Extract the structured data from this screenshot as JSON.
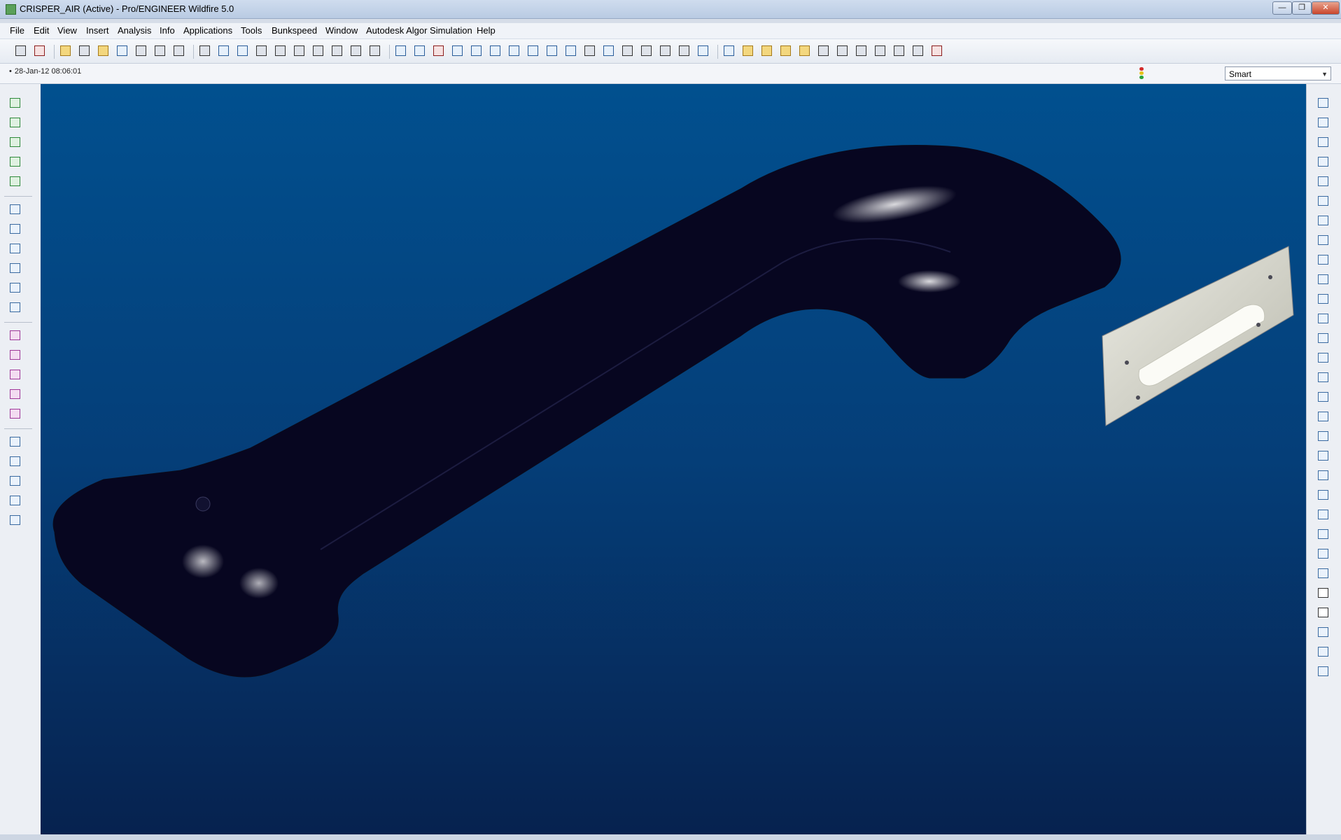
{
  "window": {
    "title": "CRISPER_AIR (Active) - Pro/ENGINEER Wildfire 5.0",
    "controls": [
      "—",
      "❐",
      "✕"
    ]
  },
  "menu": [
    "File",
    "Edit",
    "View",
    "Insert",
    "Analysis",
    "Info",
    "Applications",
    "Tools",
    "Bunkspeed",
    "Window",
    "Autodesk Algor Simulation",
    "Help"
  ],
  "status": {
    "date": "28-Jan-12 08:06:01",
    "filter_value": "Smart",
    "traffic_colors": [
      "#d42b2b",
      "#e6c21a",
      "#2aa33a"
    ]
  },
  "toolbar_icons": [
    "new-window-icon",
    "close-window-icon",
    "erase-icon",
    "new-file-icon",
    "open-folder-icon",
    "save-icon",
    "save-copy-icon",
    "print-icon",
    "email-icon",
    "model-player-icon",
    "regenerate-icon",
    "regen-manager-icon",
    "undo-icon",
    "redo-icon",
    "cut-icon",
    "copy-icon",
    "paste-icon",
    "find-icon",
    "select-box-icon",
    "shading-icon",
    "sketch-icon",
    "datum-point-icon",
    "spin-center-icon",
    "zoom-in-icon",
    "zoom-out-icon",
    "refit-icon",
    "orient-icon",
    "saved-views-icon",
    "annotation-icon",
    "coordinate-system-icon",
    "layers-icon",
    "view-manager-icon",
    "wireframe-icon",
    "hidden-line-icon",
    "no-hidden-icon",
    "shaded-icon",
    "enhanced-realism-icon",
    "datum-planes-icon",
    "datum-axes-icon",
    "datum-points-icon",
    "datum-csys-icon",
    "dimension-icon",
    "tolerance-icon",
    "note-icon",
    "surface-icon",
    "curve-icon",
    "point-cloud-icon",
    "close-all-icon"
  ],
  "left_icons": [
    "extrude-icon",
    "revolve-icon",
    "sweep-icon",
    "blend-icon",
    "boundary-icon",
    "hole-icon",
    "shell-icon",
    "rib-icon",
    "draft-icon",
    "round-icon",
    "chamfer-icon",
    "pattern-icon",
    "mirror-icon",
    "merge-icon",
    "trim-icon",
    "extend-icon",
    "offset-icon",
    "thicken-icon",
    "style-icon",
    "warp-icon",
    "freestyle-icon"
  ],
  "right_icons": [
    "find-icon",
    "layers-icon",
    "model-tree-icon",
    "open-icon",
    "save-icon",
    "edit-icon",
    "regenerate-icon",
    "flip-icon",
    "sketch-view-icon",
    "zoom-in-icon",
    "zoom-out-icon",
    "refit-icon",
    "spin-icon",
    "orient-icon",
    "saved-view-icon",
    "wireframe-icon",
    "hidden-line-icon",
    "no-hidden-icon",
    "shaded-icon",
    "analysis-icon",
    "plane-icon",
    "axis-icon",
    "point-icon",
    "curve-icon",
    "csys-icon",
    "delete-icon",
    "close-icon",
    "annotate-icon",
    "measure-icon",
    "note-icon"
  ]
}
